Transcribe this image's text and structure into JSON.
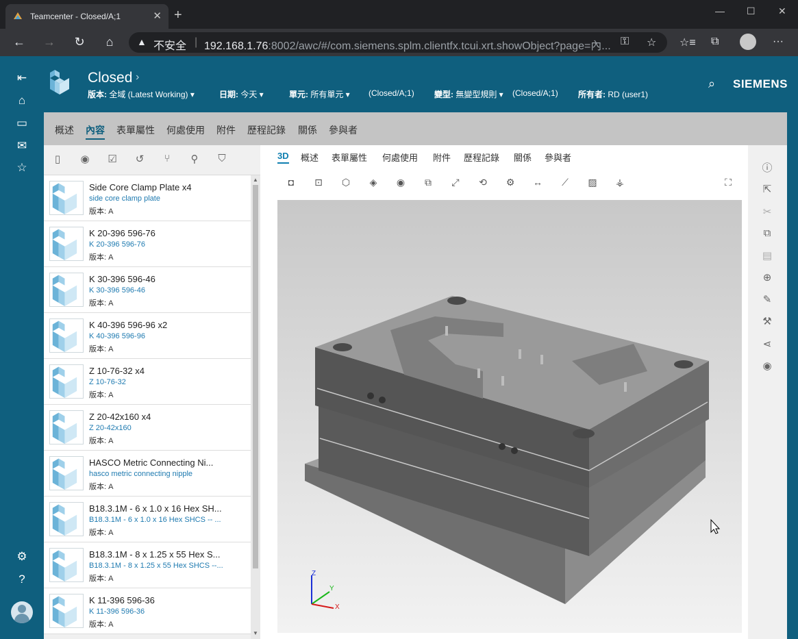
{
  "browser": {
    "tab_title": "Teamcenter - Closed/A;1",
    "tab_close": "✕",
    "new_tab": "+",
    "security_label": "不安全",
    "url_host": "192.168.1.76",
    "url_rest": ":8002/awc/#/com.siemens.splm.clientfx.tcui.xrt.showObject?page=內...",
    "window_minimize": "—",
    "window_maximize": "☐",
    "window_close": "✕"
  },
  "header": {
    "title": "Closed",
    "fields": [
      {
        "label": "版本:",
        "value": "全域 (Latest Working) ▾"
      },
      {
        "label": "日期:",
        "value": "今天 ▾"
      },
      {
        "label": "單元:",
        "value": "所有單元 ▾"
      },
      {
        "label": "",
        "value": "(Closed/A;1)"
      },
      {
        "label": "變型:",
        "value": "無變型規則 ▾"
      },
      {
        "label": "",
        "value": "(Closed/A;1)"
      },
      {
        "label": "所有者:",
        "value": "RD (user1)"
      }
    ],
    "brand": "SIEMENS"
  },
  "subtabs": [
    "概述",
    "內容",
    "表單屬性",
    "何處使用",
    "附件",
    "歷程記錄",
    "關係",
    "參與者"
  ],
  "active_subtab": "內容",
  "list": {
    "rev_label": "版本:",
    "items": [
      {
        "name": "Side Core Clamp Plate x4",
        "desc": "side core clamp plate",
        "rev": "A"
      },
      {
        "name": "K 20-396 596-76",
        "desc": "K 20-396 596-76",
        "rev": "A"
      },
      {
        "name": "K 30-396 596-46",
        "desc": "K 30-396 596-46",
        "rev": "A"
      },
      {
        "name": "K 40-396 596-96 x2",
        "desc": "K 40-396 596-96",
        "rev": "A"
      },
      {
        "name": "Z 10-76-32 x4",
        "desc": "Z 10-76-32",
        "rev": "A"
      },
      {
        "name": "Z 20-42x160 x4",
        "desc": "Z 20-42x160",
        "rev": "A"
      },
      {
        "name": "HASCO Metric Connecting Ni...",
        "desc": "hasco metric connecting nipple",
        "rev": "A"
      },
      {
        "name": "B18.3.1M - 6 x 1.0 x 16 Hex SH...",
        "desc": "B18.3.1M - 6 x 1.0 x 16 Hex SHCS -- ...",
        "rev": "A"
      },
      {
        "name": "B18.3.1M - 8 x 1.25 x 55 Hex S...",
        "desc": "B18.3.1M - 8 x 1.25 x 55 Hex SHCS --...",
        "rev": "A"
      },
      {
        "name": "K 11-396 596-36",
        "desc": "K 11-396 596-36",
        "rev": "A"
      }
    ]
  },
  "viewer": {
    "tabs": [
      "3D",
      "概述",
      "表單屬性",
      "何處使用",
      "附件",
      "歷程記錄",
      "關係",
      "參與者"
    ],
    "active_tab": "3D",
    "triad": {
      "x": "X",
      "y": "Y",
      "z": "Z"
    }
  },
  "colors": {
    "brand": "#0f5f7e",
    "accent": "#0f7fb0"
  }
}
